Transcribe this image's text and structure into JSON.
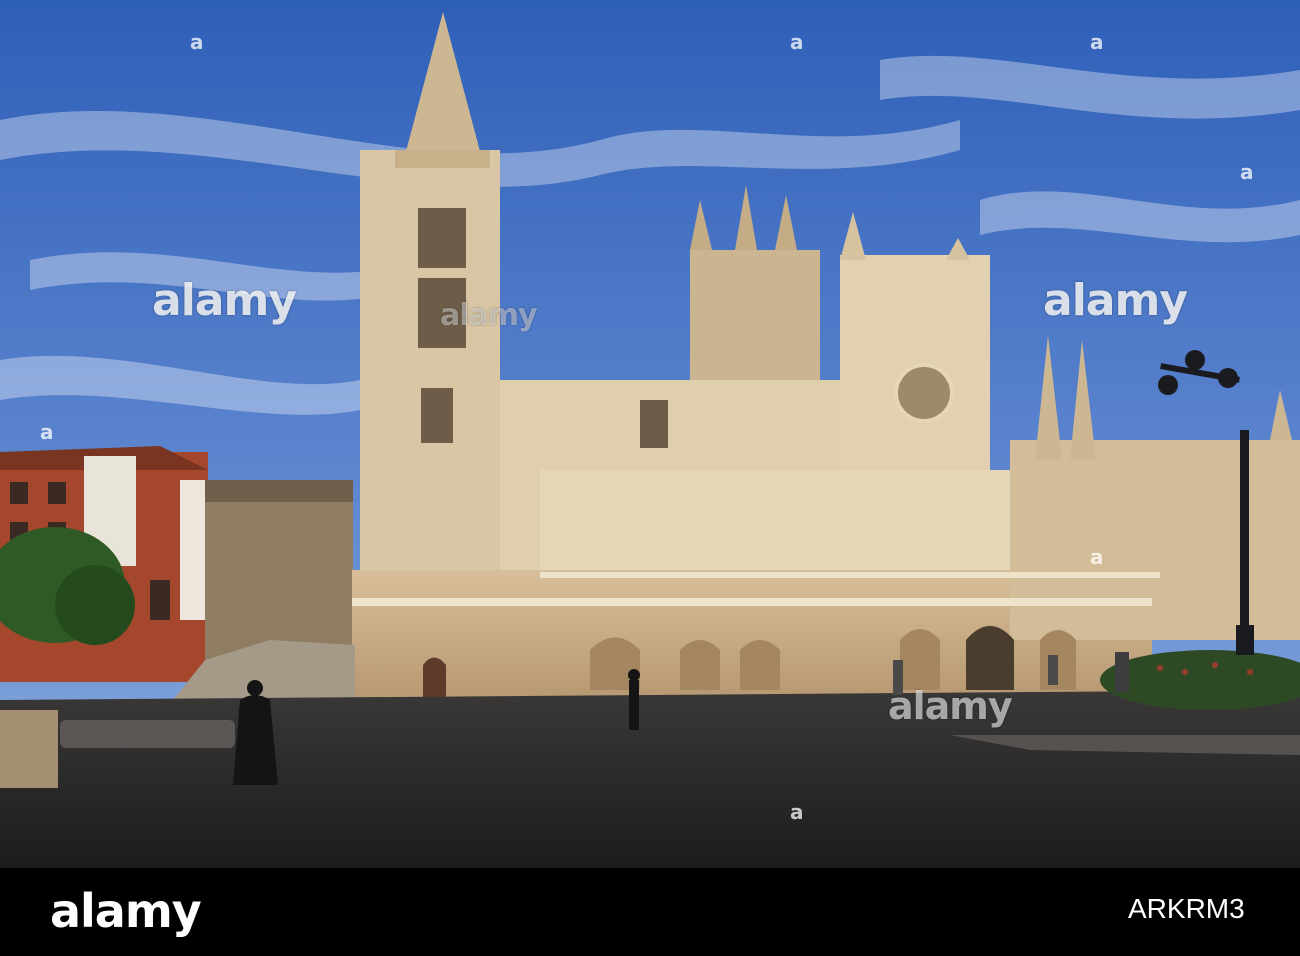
{
  "image": {
    "subject": "Gothic cathedral facade beside a cobblestone plaza under a blue sky with wispy clouds",
    "colors": {
      "sky": "#3f6fc4",
      "stone": "#e3d2b4",
      "shadow_stone": "#8f7d63",
      "plaza": "#2c2b2c",
      "brick": "#a4472c"
    }
  },
  "watermark": {
    "text": "alamy",
    "marks": [
      "alamy",
      "alamy",
      "alamy",
      "alamy"
    ],
    "dot": "a"
  },
  "footer": {
    "logo": "alamy",
    "image_id": "ARKRM3"
  }
}
